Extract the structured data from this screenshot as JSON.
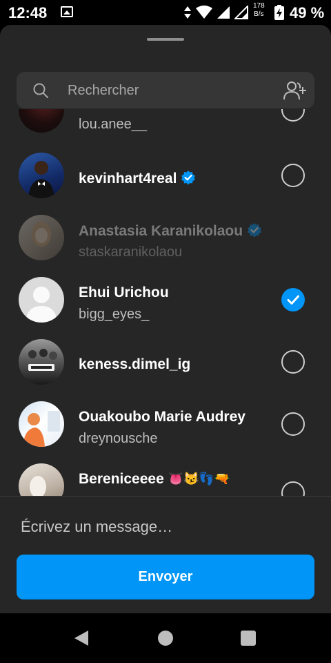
{
  "status_bar": {
    "time": "12:48",
    "net_speed_value": "178",
    "net_speed_unit": "B/s",
    "battery_percent": "49 %"
  },
  "search": {
    "placeholder": "Rechercher"
  },
  "contacts": [
    {
      "name": "",
      "username": "lou.anee__",
      "verified": false,
      "selected": false,
      "disabled": false
    },
    {
      "name": "kevinhart4real",
      "username": "",
      "verified": true,
      "selected": false,
      "disabled": false
    },
    {
      "name": "Anastasia Karanikolaou",
      "username": "staskaranikolaou",
      "verified": true,
      "selected": false,
      "disabled": true
    },
    {
      "name": "Ehui Urichou",
      "username": "bigg_eyes_",
      "verified": false,
      "selected": true,
      "disabled": false
    },
    {
      "name": "keness.dimel_ig",
      "username": "",
      "verified": false,
      "selected": false,
      "disabled": false
    },
    {
      "name": "Ouakoubo Marie Audrey",
      "username": "dreynousche",
      "verified": false,
      "selected": false,
      "disabled": false
    },
    {
      "name": "Bereniceeee",
      "name_emojis": "👅😼👣🔫",
      "username": "",
      "verified": false,
      "selected": false,
      "disabled": false
    }
  ],
  "composer": {
    "message_placeholder": "Écrivez un message…",
    "send_label": "Envoyer"
  },
  "colors": {
    "accent": "#0095f6",
    "sheet_bg": "#262626",
    "search_bg": "#363636"
  }
}
